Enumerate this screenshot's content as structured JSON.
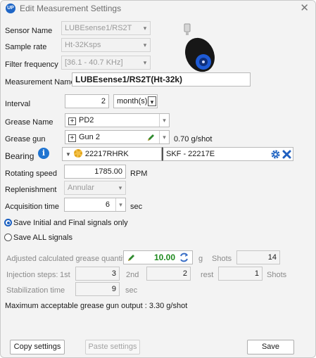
{
  "window": {
    "title": "Edit Measurement Settings",
    "close_glyph": "✕"
  },
  "sensor": {
    "name_label": "Sensor Name",
    "name_value": "LUBEsense1/RS2T",
    "rate_label": "Sample rate",
    "rate_value": "Ht-32Ksps",
    "freq_label": "Filter frequency",
    "freq_value": "[36.1 - 40.7 KHz]"
  },
  "measurement": {
    "label": "Measurement Name",
    "value": "LUBEsense1/RS2T(Ht-32k)"
  },
  "interval": {
    "label": "Interval",
    "value": "2",
    "unit": "month(s)"
  },
  "grease": {
    "label": "Grease Name",
    "value": "PD2"
  },
  "grease_gun": {
    "label": "Grease gun",
    "value": "Gun 2",
    "output": "0.70 g/shot"
  },
  "bearing": {
    "label": "Bearing",
    "code": "22217RHRK",
    "desc": "SKF - 22217E"
  },
  "rotating": {
    "label": "Rotating speed",
    "value": "1785.00",
    "unit": "RPM"
  },
  "replenishment": {
    "label": "Replenishment",
    "value": "Annular"
  },
  "acquisition": {
    "label": "Acquisition time",
    "value": "6",
    "unit": "sec"
  },
  "save_options": {
    "initial_final": "Save Initial and Final signals only",
    "all": "Save ALL signals",
    "selected": "initial_final"
  },
  "adjusted": {
    "label": "Adjusted calculated grease quantity",
    "value": "10.00",
    "unit": "g",
    "shots_label": "Shots",
    "shots_value": "14"
  },
  "injection": {
    "label": "Injection steps:",
    "first_label": "1st",
    "first_value": "3",
    "second_label": "2nd",
    "second_value": "2",
    "rest_label": "rest",
    "rest_value": "1",
    "shots_label": "Shots"
  },
  "stabilization": {
    "label": "Stabilization time",
    "value": "9",
    "unit": "sec"
  },
  "max_output": "Maximum acceptable grease gun output : 3.30 g/shot",
  "buttons": {
    "copy": "Copy settings",
    "paste": "Paste settings",
    "save": "Save"
  },
  "icons": {
    "app": "app-logo",
    "dropdown": "▾",
    "edit": "pencil",
    "bearing": "gear",
    "info": "i",
    "settings": "gear",
    "clear": "x",
    "refresh": "circular-arrows"
  },
  "colors": {
    "accent": "#1a5fc0",
    "pencil": "#2f8a2f",
    "value_green": "#1e8a1e",
    "gear": "#e0a217"
  }
}
